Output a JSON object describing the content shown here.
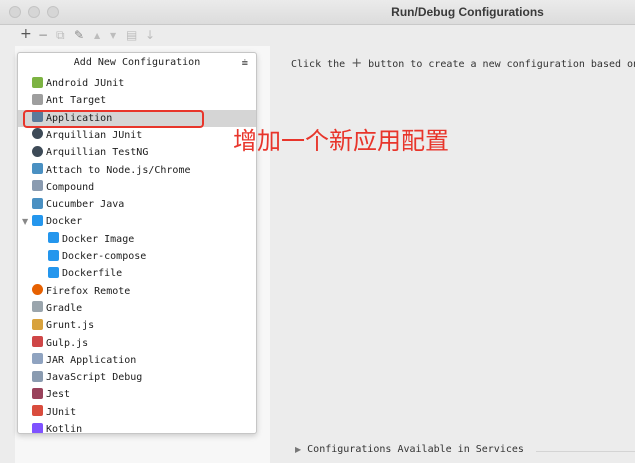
{
  "window": {
    "title": "Run/Debug Configurations"
  },
  "toolbar": {
    "add": "+",
    "remove": "−",
    "copy": "⧉",
    "edit": "✎",
    "up": "▲",
    "down": "▼",
    "move": "▤",
    "sort": "↓"
  },
  "popup": {
    "title": "Add New Configuration",
    "items": [
      {
        "label": "Android JUnit",
        "icon": "android-icon",
        "color": "#7cb342"
      },
      {
        "label": "Ant Target",
        "icon": "ant-icon",
        "color": "#9e9e9e"
      },
      {
        "label": "Application",
        "icon": "application-icon",
        "color": "#5a7a9a",
        "selected": true
      },
      {
        "label": "Arquillian JUnit",
        "icon": "arquillian-icon",
        "color": "#3d4a57"
      },
      {
        "label": "Arquillian TestNG",
        "icon": "arquillian-icon",
        "color": "#3d4a57"
      },
      {
        "label": "Attach to Node.js/Chrome",
        "icon": "attach-icon",
        "color": "#4a90c2"
      },
      {
        "label": "Compound",
        "icon": "compound-icon",
        "color": "#8a9bb0"
      },
      {
        "label": "Cucumber Java",
        "icon": "cucumber-icon",
        "color": "#4a90c2"
      },
      {
        "label": "Docker",
        "icon": "docker-icon",
        "color": "#2496ed",
        "expanded": true
      },
      {
        "label": "Docker Image",
        "icon": "docker-icon",
        "color": "#2496ed",
        "child": true
      },
      {
        "label": "Docker-compose",
        "icon": "docker-icon",
        "color": "#2496ed",
        "child": true
      },
      {
        "label": "Dockerfile",
        "icon": "docker-icon",
        "color": "#2496ed",
        "child": true
      },
      {
        "label": "Firefox Remote",
        "icon": "firefox-icon",
        "color": "#e66000"
      },
      {
        "label": "Gradle",
        "icon": "gradle-icon",
        "color": "#9aa5ad"
      },
      {
        "label": "Grunt.js",
        "icon": "grunt-icon",
        "color": "#d8a23d"
      },
      {
        "label": "Gulp.js",
        "icon": "gulp-icon",
        "color": "#cf4647"
      },
      {
        "label": "JAR Application",
        "icon": "jar-icon",
        "color": "#8fa3c0"
      },
      {
        "label": "JavaScript Debug",
        "icon": "javascript-debug-icon",
        "color": "#8a9bb0"
      },
      {
        "label": "Jest",
        "icon": "jest-icon",
        "color": "#99425b"
      },
      {
        "label": "JUnit",
        "icon": "junit-icon",
        "color": "#d94c3d"
      },
      {
        "label": "Kotlin",
        "icon": "kotlin-icon",
        "color": "#7f52ff"
      }
    ]
  },
  "main": {
    "hint_prefix": "Click the",
    "hint_plus": "+",
    "hint_suffix": "button to create a new configuration based on",
    "footer": "Configurations Available in Services"
  },
  "annotation": {
    "text": "增加一个新应用配置",
    "color": "#e8352b"
  }
}
